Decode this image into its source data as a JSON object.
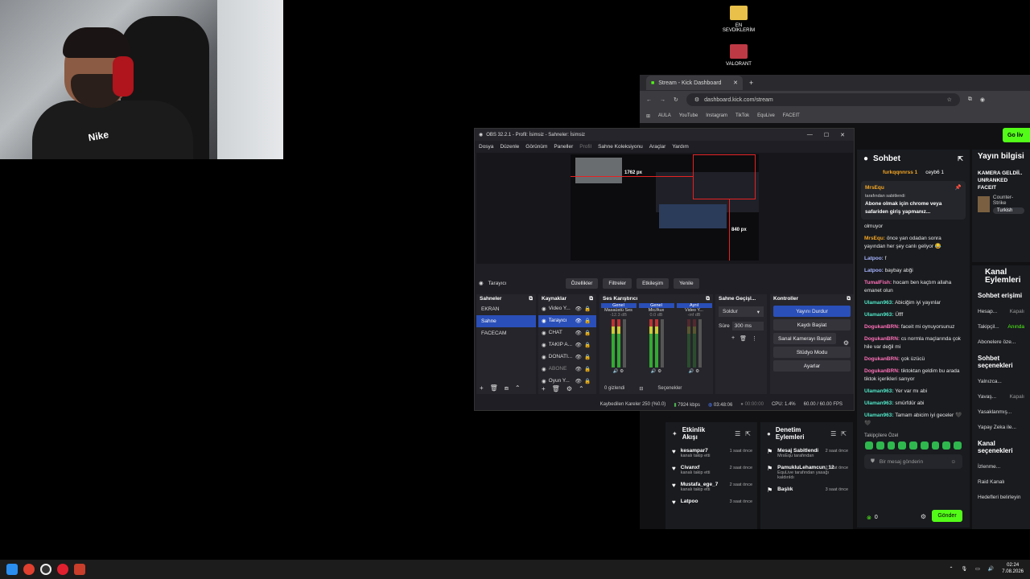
{
  "desktop": {
    "icons": [
      {
        "label": "EN\nSEVDİKLERİM",
        "icon": "folder-icon"
      },
      {
        "label": "VALORANT",
        "icon": "valorant-icon"
      }
    ]
  },
  "webcam": {
    "shirt_text": "Nike"
  },
  "browser": {
    "tab_title": "Stream - Kick Dashboard",
    "url": "dashboard.kick.com/stream",
    "bookmarks": [
      "AULA",
      "YouTube",
      "Instagram",
      "TikTok",
      "EquLive",
      "FACEIT"
    ],
    "go_live": "Go liv"
  },
  "chat": {
    "title": "Sohbet",
    "top_users": [
      "furkqqnnrss 1",
      "ceyb6 1"
    ],
    "pinned": {
      "user": "MrsEqu",
      "by": "tarafından sabitlendi",
      "text": "Abone olmak için chrome veya safariden giriş yapmanız..."
    },
    "messages": [
      {
        "user": "",
        "text": "olmuyor",
        "color": ""
      },
      {
        "user": "MrsEqu:",
        "text": "önce yan odadan sonra yayından her şey canlı geliyor 😂",
        "color": "o"
      },
      {
        "user": "Latpoo:",
        "text": "f",
        "color": "b"
      },
      {
        "user": "Latpoo:",
        "text": "baybay abği",
        "color": "b"
      },
      {
        "user": "TumalFish:",
        "text": "hocam ben kaçtım allaha emanet olun",
        "color": "p"
      },
      {
        "user": "Ulaman963:",
        "text": "Abiciğim iyi yayınlar",
        "color": "g"
      },
      {
        "user": "Ulaman963:",
        "text": "Üfff",
        "color": "g"
      },
      {
        "user": "DogukanBRN:",
        "text": "faceit mi oynuyorsunuz",
        "color": "p"
      },
      {
        "user": "DogukanBRN:",
        "text": "cs normla maçlarında çok hile var değil mi",
        "color": "p"
      },
      {
        "user": "DogukanBRN:",
        "text": "çok üzücü",
        "color": "p"
      },
      {
        "user": "DogukanBRN:",
        "text": "tiktoktan geldim bu arada tiktok içerikleri sarıyor",
        "color": "p"
      },
      {
        "user": "Ulaman963:",
        "text": "Yer var mı abi",
        "color": "g"
      },
      {
        "user": "Ulaman963:",
        "text": "smürfdür abi",
        "color": "g"
      },
      {
        "user": "Ulaman963:",
        "text": "Tamam abicim iyi geceler 🖤🖤",
        "color": "g"
      }
    ],
    "followers_only": "Takipçilere Özel",
    "input_placeholder": "Bir mesaj gönderin",
    "count": "0",
    "send": "Gönder"
  },
  "stream_info": {
    "title": "Yayın bilgisi",
    "stream_title": "KAMERA GELDİİ.. UNRANKED FACEIT",
    "category": "Counter-Strike",
    "language": "Turkish"
  },
  "channel_actions": {
    "title": "Kanal Eylemleri",
    "sections": [
      {
        "heading": "Sohbet erişimi",
        "rows": [
          [
            "Hesap...",
            "Kapalı"
          ],
          [
            "Takipçil...",
            "Anında"
          ],
          [
            "Abonelere öze...",
            ""
          ]
        ]
      },
      {
        "heading": "Sohbet seçenekleri",
        "rows": [
          [
            "Yalnızca...",
            ""
          ],
          [
            "Yavaş...",
            "Kapalı"
          ],
          [
            "Yasaklanmış...",
            ""
          ],
          [
            "Yapay Zeka ile...",
            ""
          ]
        ]
      },
      {
        "heading": "Kanal seçenekleri",
        "rows": [
          [
            "İzlenme...",
            ""
          ],
          [
            "Raid Kanalı",
            ""
          ],
          [
            "Hedefleri belirleyin",
            ""
          ]
        ]
      }
    ]
  },
  "activity": {
    "title": "Etkinlik Akışı",
    "items": [
      {
        "user": "kesampar7",
        "sub": "kanalı takip etti",
        "time": "1 saat önce"
      },
      {
        "user": "Civanxf",
        "sub": "kanalı takip etti",
        "time": "2 saat önce"
      },
      {
        "user": "Mustafa_ege_7",
        "sub": "kanalı takip etti",
        "time": "2 saat önce"
      },
      {
        "user": "Latpoo",
        "sub": "",
        "time": "3 saat önce"
      }
    ]
  },
  "moderation": {
    "title": "Denetim Eylemleri",
    "items": [
      {
        "user": "Mesaj Sabitlendi",
        "sub": "MrsEqu tarafından",
        "time": "2 saat önce"
      },
      {
        "user": "PamukluLehamcun_12",
        "sub": "EquLive tarafından yasağı kaldırıldı",
        "time": "2 saat önce"
      },
      {
        "user": "Başlık",
        "sub": "",
        "time": "3 saat önce"
      }
    ]
  },
  "obs": {
    "title": "OBS 32.2.1 - Profil: İsimsiz - Sahneler: İsimsiz",
    "menu": [
      "Dosya",
      "Düzenle",
      "Görünüm",
      "Paneller",
      "Profil",
      "Sahne Koleksiyonu",
      "Araçlar",
      "Yardım"
    ],
    "size_label_w": "1762 px",
    "size_label_h": "840 px",
    "selected_source": "Tarayıcı",
    "source_buttons": [
      "Özellikler",
      "Filtreler",
      "Etkileşim",
      "Yenile"
    ],
    "docks": {
      "scenes": {
        "title": "Sahneler",
        "items": [
          "EKRAN",
          "Sahne",
          "FACECAM"
        ],
        "selected": 1
      },
      "sources": {
        "title": "Kaynaklar",
        "items": [
          "Video Y...",
          "Tarayıcı",
          "CHAT",
          "TAKİP A...",
          "DONATI...",
          "ABONE",
          "Oyun Y..."
        ]
      },
      "mixer": {
        "title": "Ses Karıştırıcı",
        "channels": [
          "Masaüstü Ses",
          "Mic/Aux",
          "Video Y..."
        ],
        "tags": [
          "Genel",
          "Genel",
          "Ayrıl"
        ],
        "db": [
          "-12.3 dB",
          "0.0 dB",
          "-inf dB"
        ],
        "hidden": "0 gizlendi",
        "options": "Seçenekler"
      },
      "transitions": {
        "title": "Sahne Geçişl...",
        "type": "Soldur",
        "dur_label": "Süre",
        "duration": "300 ms"
      },
      "controls": {
        "title": "Kontroller",
        "buttons": [
          "Yayını Durdur",
          "Kaydı Başlat",
          "Sanal Kamerayı Başlat",
          "Stüdyo Modu",
          "Ayarlar"
        ]
      }
    },
    "status": {
      "dropped": "Kaybedilen Kareler 250 (%0.0)",
      "kbps": "7924 kbps",
      "live_time": "03:48:06",
      "rec_time": "00:00:00",
      "cpu": "CPU: 1.4%",
      "fps": "60.00 / 60.00 FPS"
    }
  },
  "taskbar": {
    "time": "02:24",
    "date": "7.08.2026"
  }
}
